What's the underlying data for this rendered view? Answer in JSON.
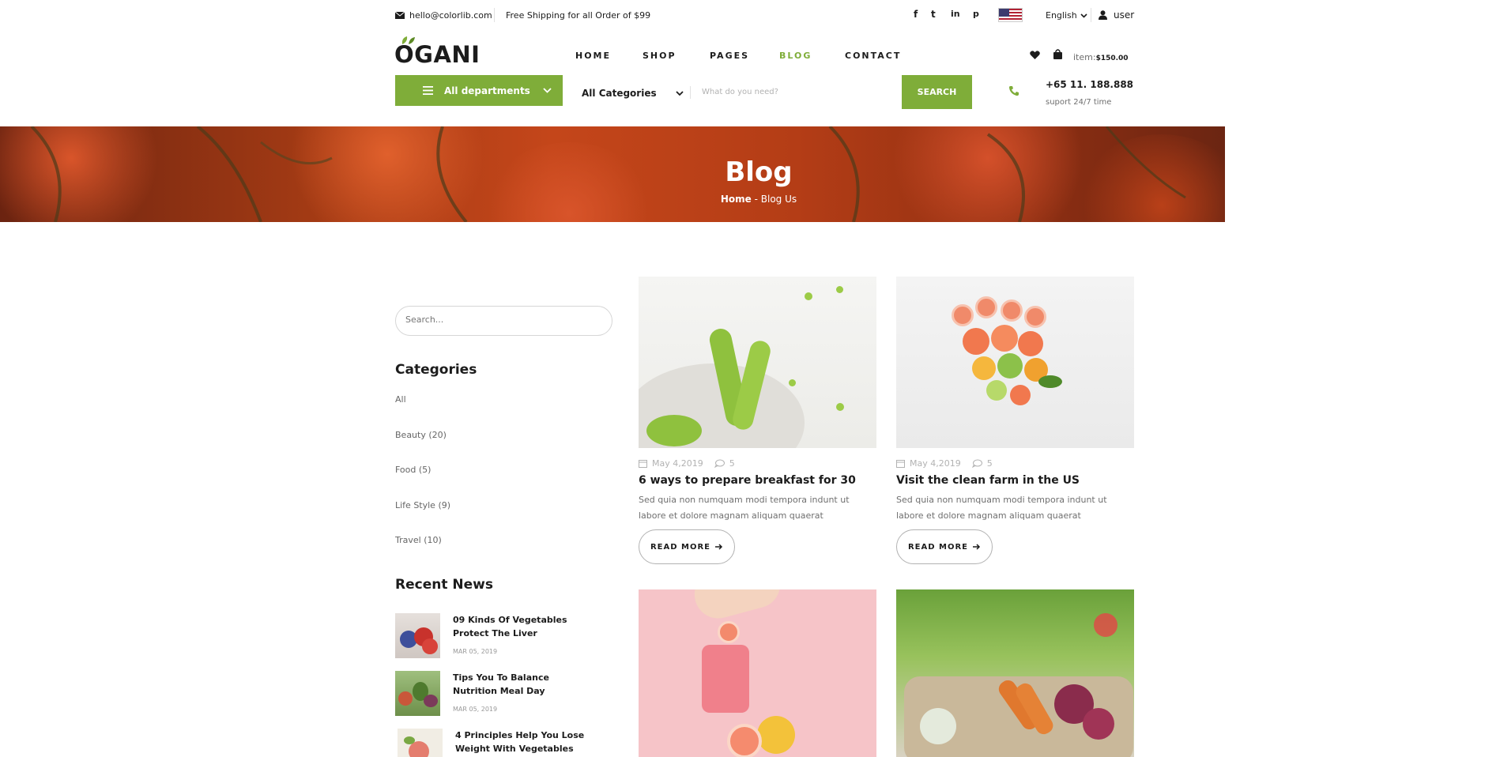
{
  "topbar": {
    "email": "hello@colorlib.com",
    "shipping": "Free Shipping for all Order of $99",
    "social": [
      "f",
      "t",
      "in",
      "p"
    ],
    "language": "English",
    "user": "user"
  },
  "header": {
    "logo": "OGANI",
    "nav": [
      {
        "label": "HOME",
        "active": false
      },
      {
        "label": "SHOP",
        "active": false
      },
      {
        "label": "PAGES",
        "active": false
      },
      {
        "label": "BLOG",
        "active": true
      },
      {
        "label": "CONTACT",
        "active": false
      }
    ],
    "cart_label": "item:",
    "cart_total": "$150.00"
  },
  "search": {
    "departments": "All departments",
    "category": "All Categories",
    "placeholder": "What do you need?",
    "button": "SEARCH",
    "phone": "+65 11. 188.888",
    "support": "suport 24/7 time"
  },
  "banner": {
    "title": "Blog",
    "crumb_home": "Home",
    "crumb_current": "Blog Us"
  },
  "sidebar": {
    "search_placeholder": "Search...",
    "categories_title": "Categories",
    "categories": [
      "All",
      "Beauty (20)",
      "Food (5)",
      "Life Style (9)",
      "Travel (10)"
    ],
    "recent_title": "Recent News",
    "recent": [
      {
        "title": "09 Kinds Of Vegetables Protect The Liver",
        "date": "MAR 05, 2019"
      },
      {
        "title": "Tips You To Balance Nutrition Meal Day",
        "date": "MAR 05, 2019"
      },
      {
        "title": "4 Principles Help You Lose Weight With Vegetables",
        "date": ""
      }
    ]
  },
  "posts": [
    {
      "date": "May 4,2019",
      "comments": "5",
      "title": "6 ways to prepare breakfast for 30",
      "text": "Sed quia non numquam modi tempora indunt ut labore et dolore magnam aliquam quaerat",
      "cta": "READ MORE"
    },
    {
      "date": "May 4,2019",
      "comments": "5",
      "title": "Visit the clean farm in the US",
      "text": "Sed quia non numquam modi tempora indunt ut labore et dolore magnam aliquam quaerat",
      "cta": "READ MORE"
    }
  ],
  "colors": {
    "accent": "#7fad39",
    "text": "#1c1c1c"
  }
}
